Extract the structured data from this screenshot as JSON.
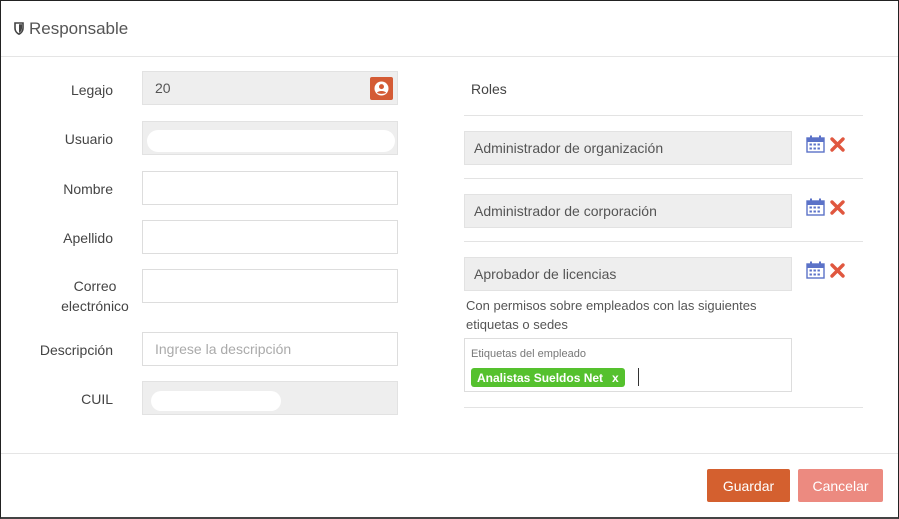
{
  "modal": {
    "title": "Responsable",
    "title_icon": "shield-icon"
  },
  "form": {
    "legajo": {
      "label": "Legajo",
      "value": "20",
      "button_icon": "user-circle-icon"
    },
    "usuario": {
      "label": "Usuario"
    },
    "nombre": {
      "label": "Nombre"
    },
    "apellido": {
      "label": "Apellido"
    },
    "correo": {
      "label_line1": "Correo",
      "label_line2": "electrónico"
    },
    "descripcion": {
      "label": "Descripción",
      "placeholder": "Ingrese la descripción"
    },
    "cuil": {
      "label": "CUIL"
    }
  },
  "roles": {
    "title": "Roles",
    "items": [
      {
        "name": "Administrador de organización"
      },
      {
        "name": "Administrador de corporación"
      },
      {
        "name": "Aprobador de licencias"
      }
    ],
    "permissions_text": "Con permisos sobre empleados con las siguientes etiquetas o sedes",
    "tags_label": "Etiquetas del empleado",
    "tags": [
      {
        "label": "Analistas Sueldos Net",
        "remove": "x"
      }
    ]
  },
  "footer": {
    "save_label": "Guardar",
    "cancel_label": "Cancelar"
  },
  "colors": {
    "primary": "#d4602f",
    "secondary": "#ec8a80",
    "tag": "#55c12e",
    "delete": "#e0573f",
    "calendar": "#5b72c8"
  }
}
